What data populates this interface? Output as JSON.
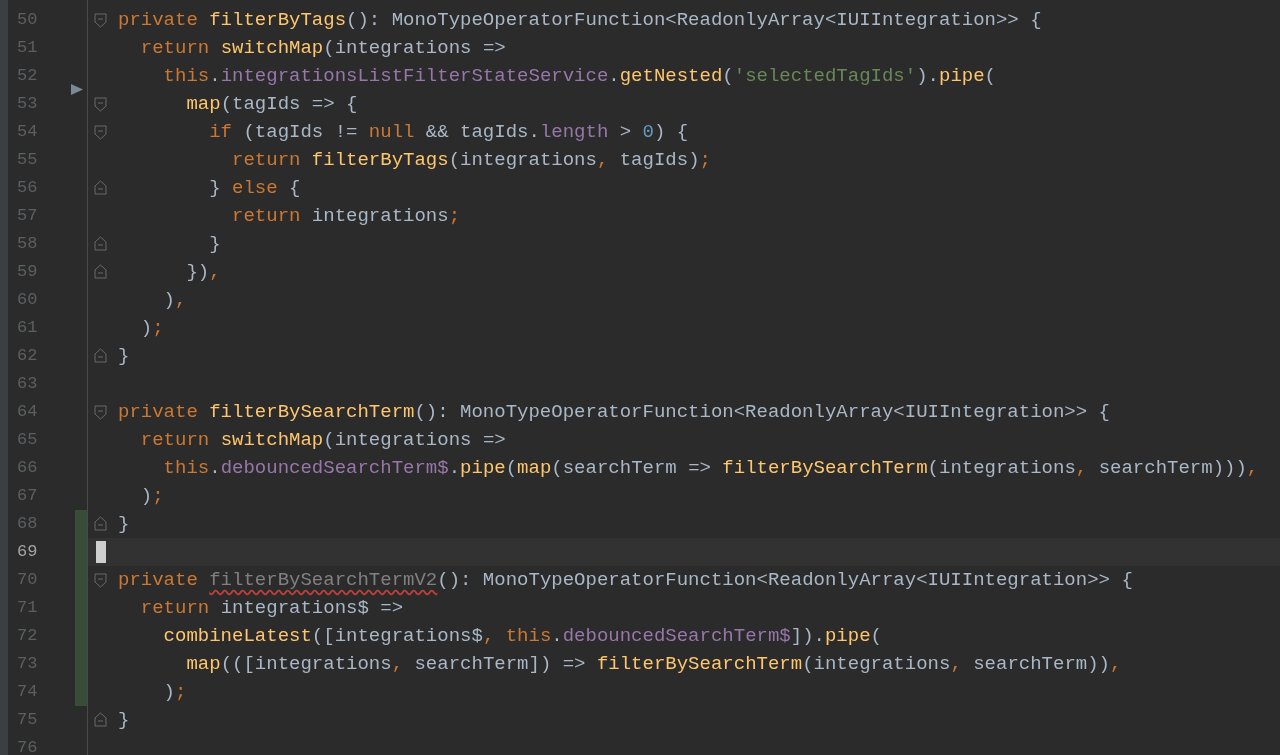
{
  "editor": {
    "lines": [
      {
        "number": "50",
        "fold_start": true,
        "fold_end": false,
        "changed": false,
        "current": false,
        "arrow": false,
        "tokens": [
          {
            "kind": "keyword",
            "text": "private "
          },
          {
            "kind": "function",
            "text": "filterByTags"
          },
          {
            "kind": "plain",
            "text": "(): MonoTypeOperatorFunction<ReadonlyArray<IUIIntegration>> {"
          }
        ]
      },
      {
        "number": "51",
        "fold_start": false,
        "fold_end": false,
        "changed": false,
        "current": false,
        "arrow": false,
        "tokens": [
          {
            "kind": "keyword",
            "text": "  return "
          },
          {
            "kind": "function",
            "text": "switchMap"
          },
          {
            "kind": "plain",
            "text": "(integrations =>"
          }
        ]
      },
      {
        "number": "52",
        "fold_start": false,
        "fold_end": false,
        "changed": false,
        "current": false,
        "arrow": true,
        "tokens": [
          {
            "kind": "keyword",
            "text": "    this"
          },
          {
            "kind": "plain",
            "text": "."
          },
          {
            "kind": "field",
            "text": "integrationsListFilterStateService"
          },
          {
            "kind": "plain",
            "text": "."
          },
          {
            "kind": "function",
            "text": "getNested"
          },
          {
            "kind": "plain",
            "text": "("
          },
          {
            "kind": "string",
            "text": "'selectedTagIds'"
          },
          {
            "kind": "plain",
            "text": ")."
          },
          {
            "kind": "function",
            "text": "pipe"
          },
          {
            "kind": "plain",
            "text": "("
          }
        ]
      },
      {
        "number": "53",
        "fold_start": true,
        "fold_end": false,
        "changed": false,
        "current": false,
        "arrow": false,
        "tokens": [
          {
            "kind": "function",
            "text": "      map"
          },
          {
            "kind": "plain",
            "text": "(tagIds => {"
          }
        ]
      },
      {
        "number": "54",
        "fold_start": true,
        "fold_end": false,
        "changed": false,
        "current": false,
        "arrow": false,
        "tokens": [
          {
            "kind": "keyword",
            "text": "        if "
          },
          {
            "kind": "plain",
            "text": "(tagIds != "
          },
          {
            "kind": "keyword",
            "text": "null "
          },
          {
            "kind": "plain",
            "text": "&& tagIds."
          },
          {
            "kind": "field",
            "text": "length"
          },
          {
            "kind": "plain",
            "text": " > "
          },
          {
            "kind": "number",
            "text": "0"
          },
          {
            "kind": "plain",
            "text": ") {"
          }
        ]
      },
      {
        "number": "55",
        "fold_start": false,
        "fold_end": false,
        "changed": false,
        "current": false,
        "arrow": false,
        "tokens": [
          {
            "kind": "keyword",
            "text": "          return "
          },
          {
            "kind": "function",
            "text": "filterByTags"
          },
          {
            "kind": "plain",
            "text": "(integrations"
          },
          {
            "kind": "keyword",
            "text": ", "
          },
          {
            "kind": "plain",
            "text": "tagIds)"
          },
          {
            "kind": "keyword",
            "text": ";"
          }
        ]
      },
      {
        "number": "56",
        "fold_start": false,
        "fold_end": true,
        "changed": false,
        "current": false,
        "arrow": false,
        "tokens": [
          {
            "kind": "plain",
            "text": "        } "
          },
          {
            "kind": "keyword",
            "text": "else "
          },
          {
            "kind": "plain",
            "text": "{"
          }
        ]
      },
      {
        "number": "57",
        "fold_start": false,
        "fold_end": false,
        "changed": false,
        "current": false,
        "arrow": false,
        "tokens": [
          {
            "kind": "keyword",
            "text": "          return "
          },
          {
            "kind": "plain",
            "text": "integrations"
          },
          {
            "kind": "keyword",
            "text": ";"
          }
        ]
      },
      {
        "number": "58",
        "fold_start": false,
        "fold_end": true,
        "changed": false,
        "current": false,
        "arrow": false,
        "tokens": [
          {
            "kind": "plain",
            "text": "        }"
          }
        ]
      },
      {
        "number": "59",
        "fold_start": false,
        "fold_end": true,
        "changed": false,
        "current": false,
        "arrow": false,
        "tokens": [
          {
            "kind": "plain",
            "text": "      })"
          },
          {
            "kind": "keyword",
            "text": ","
          }
        ]
      },
      {
        "number": "60",
        "fold_start": false,
        "fold_end": false,
        "changed": false,
        "current": false,
        "arrow": false,
        "tokens": [
          {
            "kind": "plain",
            "text": "    )"
          },
          {
            "kind": "keyword",
            "text": ","
          }
        ]
      },
      {
        "number": "61",
        "fold_start": false,
        "fold_end": false,
        "changed": false,
        "current": false,
        "arrow": false,
        "tokens": [
          {
            "kind": "plain",
            "text": "  )"
          },
          {
            "kind": "keyword",
            "text": ";"
          }
        ]
      },
      {
        "number": "62",
        "fold_start": false,
        "fold_end": true,
        "changed": false,
        "current": false,
        "arrow": false,
        "tokens": [
          {
            "kind": "plain",
            "text": "}"
          }
        ]
      },
      {
        "number": "63",
        "fold_start": false,
        "fold_end": false,
        "changed": false,
        "current": false,
        "arrow": false
      },
      {
        "number": "64",
        "fold_start": true,
        "fold_end": false,
        "changed": false,
        "current": false,
        "arrow": false,
        "tokens": [
          {
            "kind": "keyword",
            "text": "private "
          },
          {
            "kind": "function",
            "text": "filterBySearchTerm"
          },
          {
            "kind": "plain",
            "text": "(): MonoTypeOperatorFunction<ReadonlyArray<IUIIntegration>> {"
          }
        ]
      },
      {
        "number": "65",
        "fold_start": false,
        "fold_end": false,
        "changed": false,
        "current": false,
        "arrow": false,
        "tokens": [
          {
            "kind": "keyword",
            "text": "  return "
          },
          {
            "kind": "function",
            "text": "switchMap"
          },
          {
            "kind": "plain",
            "text": "(integrations =>"
          }
        ]
      },
      {
        "number": "66",
        "fold_start": false,
        "fold_end": false,
        "changed": false,
        "current": false,
        "arrow": false,
        "tokens": [
          {
            "kind": "keyword",
            "text": "    this"
          },
          {
            "kind": "plain",
            "text": "."
          },
          {
            "kind": "field",
            "text": "debouncedSearchTerm$"
          },
          {
            "kind": "plain",
            "text": "."
          },
          {
            "kind": "function",
            "text": "pipe"
          },
          {
            "kind": "plain",
            "text": "("
          },
          {
            "kind": "function",
            "text": "map"
          },
          {
            "kind": "plain",
            "text": "(searchTerm => "
          },
          {
            "kind": "function",
            "text": "filterBySearchTerm"
          },
          {
            "kind": "plain",
            "text": "(integrations"
          },
          {
            "kind": "keyword",
            "text": ", "
          },
          {
            "kind": "plain",
            "text": "searchTerm)))"
          },
          {
            "kind": "keyword",
            "text": ","
          }
        ]
      },
      {
        "number": "67",
        "fold_start": false,
        "fold_end": false,
        "changed": false,
        "current": false,
        "arrow": false,
        "tokens": [
          {
            "kind": "plain",
            "text": "  )"
          },
          {
            "kind": "keyword",
            "text": ";"
          }
        ]
      },
      {
        "number": "68",
        "fold_start": false,
        "fold_end": true,
        "changed": true,
        "current": false,
        "arrow": false,
        "tokens": [
          {
            "kind": "plain",
            "text": "}"
          }
        ]
      },
      {
        "number": "69",
        "fold_start": false,
        "fold_end": false,
        "changed": true,
        "current": true,
        "arrow": false
      },
      {
        "number": "70",
        "fold_start": true,
        "fold_end": false,
        "changed": true,
        "current": false,
        "arrow": false,
        "tokens": [
          {
            "kind": "keyword",
            "text": "private "
          },
          {
            "kind": "unused",
            "text": "filterBySearchTermV2"
          },
          {
            "kind": "plain",
            "text": "(): MonoTypeOperatorFunction<ReadonlyArray<IUIIntegration>> {"
          }
        ]
      },
      {
        "number": "71",
        "fold_start": false,
        "fold_end": false,
        "changed": true,
        "current": false,
        "arrow": false,
        "tokens": [
          {
            "kind": "keyword",
            "text": "  return "
          },
          {
            "kind": "plain",
            "text": "integrations$ =>"
          }
        ]
      },
      {
        "number": "72",
        "fold_start": false,
        "fold_end": false,
        "changed": true,
        "current": false,
        "arrow": false,
        "tokens": [
          {
            "kind": "function",
            "text": "    combineLatest"
          },
          {
            "kind": "plain",
            "text": "([integrations$"
          },
          {
            "kind": "keyword",
            "text": ", this"
          },
          {
            "kind": "plain",
            "text": "."
          },
          {
            "kind": "field",
            "text": "debouncedSearchTerm$"
          },
          {
            "kind": "plain",
            "text": "])."
          },
          {
            "kind": "function",
            "text": "pipe"
          },
          {
            "kind": "plain",
            "text": "("
          }
        ]
      },
      {
        "number": "73",
        "fold_start": false,
        "fold_end": false,
        "changed": true,
        "current": false,
        "arrow": false,
        "tokens": [
          {
            "kind": "function",
            "text": "      map"
          },
          {
            "kind": "plain",
            "text": "(([integrations"
          },
          {
            "kind": "keyword",
            "text": ", "
          },
          {
            "kind": "plain",
            "text": "searchTerm]) => "
          },
          {
            "kind": "function",
            "text": "filterBySearchTerm"
          },
          {
            "kind": "plain",
            "text": "(integrations"
          },
          {
            "kind": "keyword",
            "text": ", "
          },
          {
            "kind": "plain",
            "text": "searchTerm))"
          },
          {
            "kind": "keyword",
            "text": ","
          }
        ]
      },
      {
        "number": "74",
        "fold_start": false,
        "fold_end": false,
        "changed": true,
        "current": false,
        "arrow": false,
        "tokens": [
          {
            "kind": "plain",
            "text": "    )"
          },
          {
            "kind": "keyword",
            "text": ";"
          }
        ]
      },
      {
        "number": "75",
        "fold_start": false,
        "fold_end": true,
        "changed": false,
        "current": false,
        "arrow": false,
        "tokens": [
          {
            "kind": "plain",
            "text": "}"
          }
        ]
      },
      {
        "number": "76",
        "fold_start": false,
        "fold_end": false,
        "changed": false,
        "current": false,
        "arrow": false
      }
    ]
  }
}
